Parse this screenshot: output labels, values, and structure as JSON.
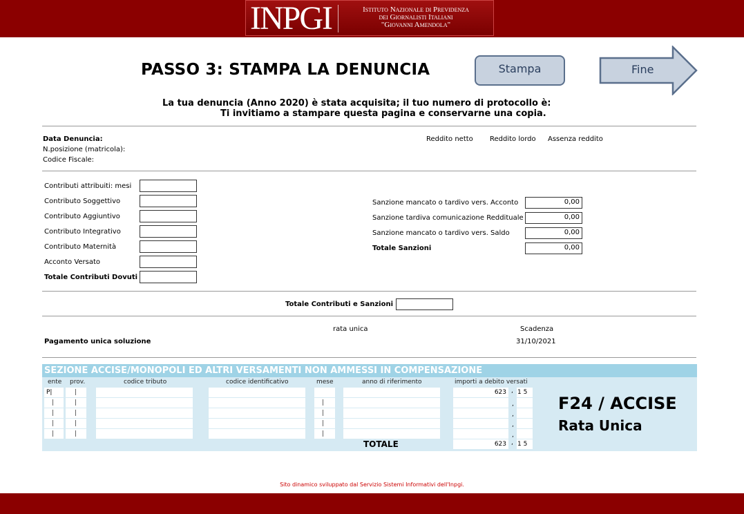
{
  "header": {
    "logo_mark": "INPGI",
    "logo_lines": [
      "Istituto Nazionale di Previdenza",
      "dei Giornalisti Italiani",
      "\"Giovanni Amendola\""
    ]
  },
  "page": {
    "title": "PASSO 3: STAMPA LA DENUNCIA",
    "print_button": "Stampa",
    "finish_button": "Fine",
    "message_line1": "La tua denuncia (Anno 2020) è stata acquisita; il tuo numero di protocollo è:",
    "message_line2": "Ti invitiamo a stampare questa pagina e conservarne una copia."
  },
  "info": {
    "data_denuncia_label": "Data Denuncia:",
    "posizione_label": "N.posizione (matricola):",
    "codice_fiscale_label": "Codice Fiscale:",
    "reddito_netto": "Reddito netto",
    "reddito_lordo": "Reddito lordo",
    "assenza_reddito": "Assenza reddito"
  },
  "contributi": {
    "mesi": "Contributi attribuiti: mesi",
    "soggettivo": "Contributo Soggettivo",
    "aggiuntivo": "Contributo Aggiuntivo",
    "integrativo": "Contributo Integrativo",
    "maternita": "Contributo Maternità",
    "acconto": "Acconto Versato",
    "totale": "Totale Contributi Dovuti"
  },
  "sanzioni": {
    "acconto_label": "Sanzione mancato o tardivo vers. Acconto",
    "acconto_value": "0,00",
    "tardiva_label": "Sanzione tardiva comunicazione Reddituale",
    "tardiva_value": "0,00",
    "saldo_label": "Sanzione mancato o tardivo vers. Saldo",
    "saldo_value": "0,00",
    "totale_label": "Totale Sanzioni",
    "totale_value": "0,00"
  },
  "totale_cs_label": "Totale Contributi e Sanzioni",
  "pagamento": {
    "rata_unica": "rata unica",
    "scadenza": "Scadenza",
    "label": "Pagamento unica soluzione",
    "date": "31/10/2021"
  },
  "f24": {
    "heading": "SEZIONE ACCISE/MONOPOLI ED ALTRI VERSAMENTI NON AMMESSI IN COMPENSAZIONE",
    "columns": {
      "ente": "ente",
      "prov": "prov.",
      "codice_tributo": "codice tributo",
      "codice_identificativo": "codice identificativo",
      "mese": "mese",
      "anno": "anno di riferimento",
      "importi": "importi a debito versati"
    },
    "row1_ente": "P|",
    "row1_amount": "623",
    "row1_cents": "1 5",
    "totale_label": "TOTALE",
    "totale_amount": "623",
    "totale_cents": "1 5",
    "title": "F24 / ACCISE",
    "subtitle": "Rata Unica"
  },
  "footer_note": "Sito dinamico sviluppato dal Servizio Sistemi Informativi dell'Inpgi."
}
